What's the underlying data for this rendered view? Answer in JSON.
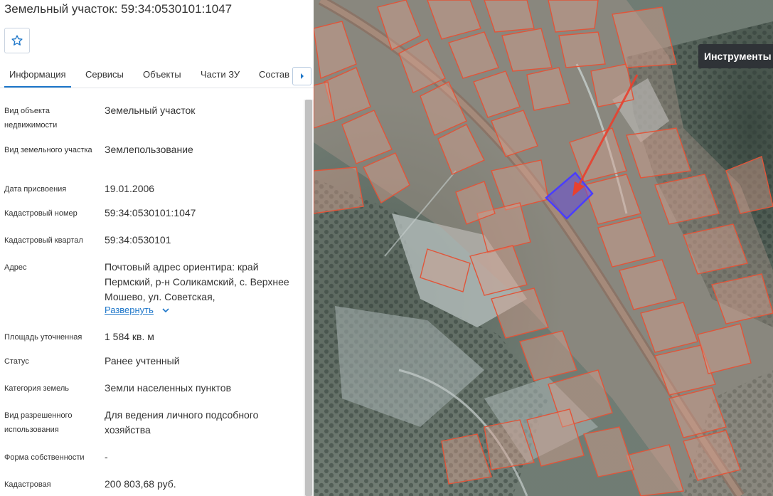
{
  "panel": {
    "title": "Земельный участок: 59:34:0530101:1047",
    "favorite_icon": "star-outline-icon",
    "tabs": [
      {
        "label": "Информация",
        "active": true
      },
      {
        "label": "Сервисы",
        "active": false
      },
      {
        "label": "Объекты",
        "active": false
      },
      {
        "label": "Части ЗУ",
        "active": false
      },
      {
        "label": "Состав",
        "active": false
      }
    ],
    "tabs_scroll_icon": "caret-right-icon",
    "rows": [
      {
        "label": "Вид объекта недвижимости",
        "value": "Земельный участок"
      },
      {
        "label": "Вид земельного участка",
        "value": "Землепользование"
      },
      {
        "label": "Дата присвоения",
        "value": "19.01.2006"
      },
      {
        "label": "Кадастровый номер",
        "value": "59:34:0530101:1047"
      },
      {
        "label": "Кадастровый квартал",
        "value": "59:34:0530101"
      },
      {
        "label": "Адрес",
        "value": "Почтовый адрес ориентира: край Пермский, р-н Соликамский, с. Верхнее Мошево, ул. Советская,"
      },
      {
        "label": "Площадь уточненная",
        "value": "1 584 кв. м"
      },
      {
        "label": "Статус",
        "value": "Ранее учтенный"
      },
      {
        "label": "Категория земель",
        "value": "Земли населенных пунктов"
      },
      {
        "label": "Вид разрешенного использования",
        "value": "Для ведения личного подсобного хозяйства"
      },
      {
        "label": "Форма собственности",
        "value": "-"
      },
      {
        "label": "Кадастровая",
        "value": "200 803,68 руб."
      }
    ],
    "expand_label": "Развернуть",
    "expand_icon": "chevron-down-icon"
  },
  "map": {
    "tools_tooltip": "Инструменты",
    "parcel_outline_color": "#e0553a",
    "selected_parcel_color": "#4a3dff",
    "arrow_color": "#e8412f"
  }
}
